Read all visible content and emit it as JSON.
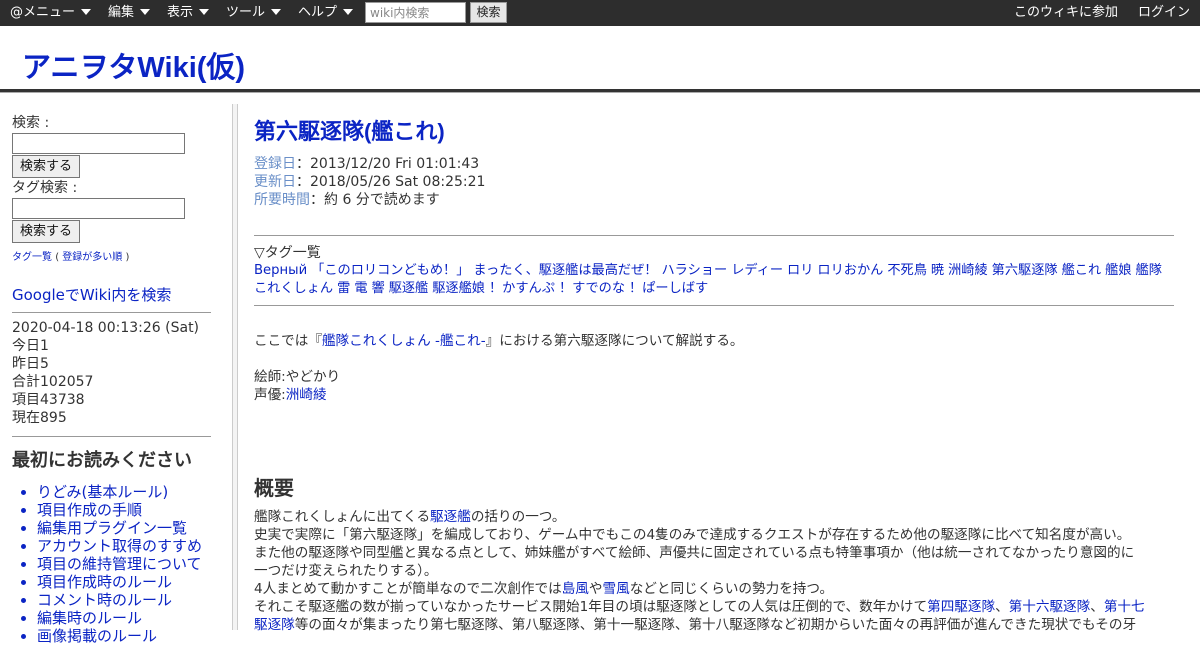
{
  "topbar": {
    "menus": [
      "@メニュー",
      "編集",
      "表示",
      "ツール",
      "ヘルプ"
    ],
    "search_placeholder": "wiki内検索",
    "search_button": "検索",
    "join_label": "このウィキに参加",
    "login_label": "ログイン"
  },
  "site": {
    "title": "アニヲタWiki(仮)"
  },
  "sidebar": {
    "search_label": "検索 :",
    "search_button": "検索する",
    "tag_search_label": "タグ検索 :",
    "tag_search_button": "検索する",
    "tag_list_link": "タグ一覧",
    "tag_list_paren_open": "(",
    "tag_popular_link": "登録が多い順",
    "tag_list_paren_close": ")",
    "google_search_link": "GoogleでWiki内を検索",
    "stats": {
      "datetime": "2020-04-18 00:13:26 (Sat)",
      "today": "今日1",
      "yesterday": "昨日5",
      "total": "合計102057",
      "items": "項目43738",
      "current": "現在895"
    },
    "read_first_heading": "最初にお読みください",
    "read_first_items": [
      "りどみ(基本ルール)",
      "項目作成の手順",
      "編集用プラグイン一覧",
      "アカウント取得のすすめ",
      "項目の維持管理について",
      "項目作成時のルール",
      "コメント時のルール",
      "編集時のルール",
      "画像掲載のルール"
    ]
  },
  "page": {
    "title": "第六駆逐隊(艦これ)",
    "registered_label": "登録日",
    "registered_value": "：2013/12/20 Fri 01:01:43",
    "updated_label": "更新日",
    "updated_value": "：2018/05/26 Sat 08:25:21",
    "readtime_label": "所要時間",
    "readtime_value": "：約 6 分で読めます",
    "tags_heading": "▽タグ一覧",
    "tags": [
      "Верный",
      "「このロリコンどもめ！」",
      "まったく、駆逐艦は最高だぜ！",
      "ハラショー",
      "レディー",
      "ロリ",
      "ロリおかん",
      "不死鳥",
      "暁",
      "洲崎綾",
      "第六駆逐隊",
      "艦これ",
      "艦娘",
      "艦隊これくしょん",
      "雷",
      "電",
      "響",
      "駆逐艦",
      "駆逐艦娘",
      "！かすんぷ",
      "！すでのな",
      "！ぱーしばす"
    ],
    "intro_before": "ここでは『",
    "intro_link": "艦隊これくしょん -艦これ-",
    "intro_after": "』における第六駆逐隊について解説する。",
    "illustrator": "絵師:やどかり",
    "voice_label": "声優:",
    "voice_link": "洲崎綾",
    "overview_heading": "概要",
    "ov1_before": "艦隊これくしょんに出てくる",
    "ov1_link": "駆逐艦",
    "ov1_after": "の括りの一つ。",
    "ov2": "史実で実際に「第六駆逐隊」を編成しており、ゲーム中でもこの4隻のみで達成するクエストが存在するため他の駆逐隊に比べて知名度が高い。",
    "ov3": "また他の駆逐隊や同型艦と異なる点として、姉妹艦がすべて絵師、声優共に固定されている点も特筆事項か（他は統一されてなかったり意図的に",
    "ov4": "一つだけ変えられたりする）。",
    "ov5_before": "4人まとめて動かすことが簡単なので二次創作では",
    "ov5_link1": "島風",
    "ov5_mid": "や",
    "ov5_link2": "雪風",
    "ov5_after": "などと同じくらいの勢力を持つ。",
    "ov6_before": "それこそ駆逐艦の数が揃っていなかったサービス開始1年目の頃は駆逐隊としての人気は圧倒的で、数年かけて",
    "ov6_link1": "第四駆逐隊",
    "ov6_sep1": "、",
    "ov6_link2": "第十六駆逐隊",
    "ov6_sep2": "、",
    "ov6_link3": "第十七",
    "ov7_link": "駆逐隊",
    "ov7_after": "等の面々が集まったり第七駆逐隊、第八駆逐隊、第十一駆逐隊、第十八駆逐隊など初期からいた面々の再評価が進んできた現状でもその牙"
  }
}
